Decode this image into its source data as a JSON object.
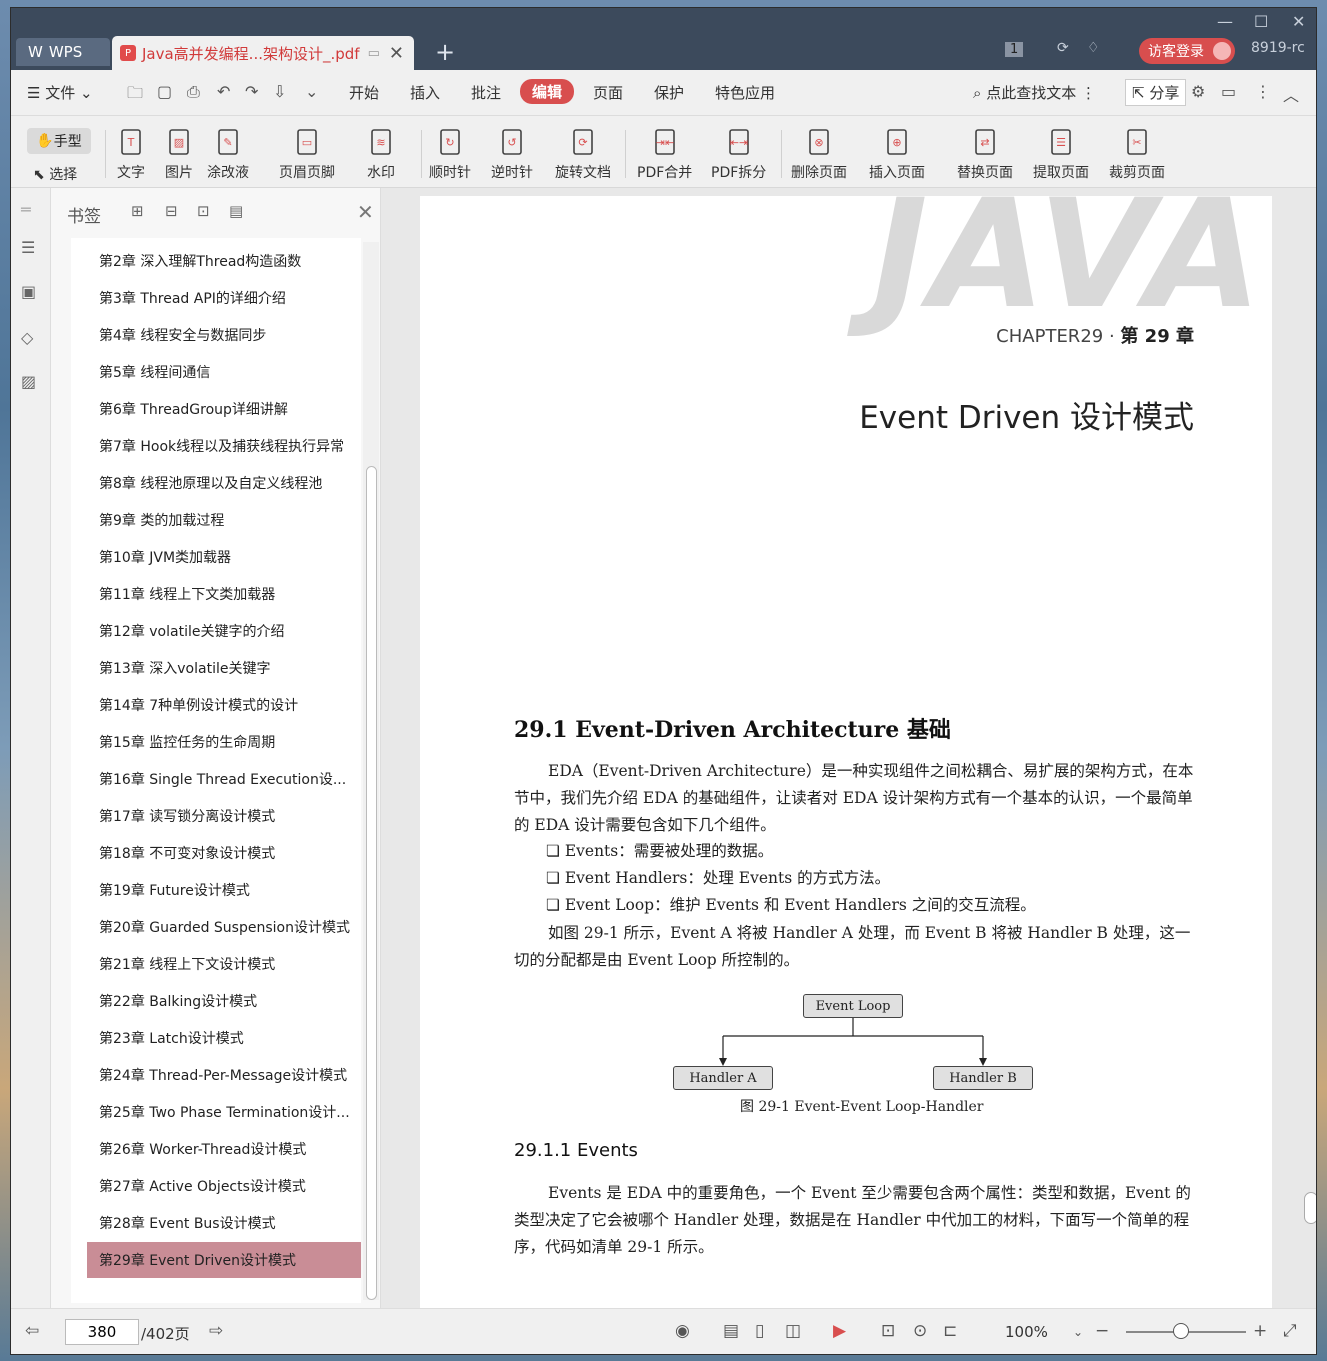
{
  "app": {
    "name": "WPS",
    "tab_title": "Java高并发编程...架构设计_.pdf",
    "tab_count": "1",
    "login": "访客登录",
    "user": "8919-rc"
  },
  "menu": {
    "file": "文件",
    "items": [
      "开始",
      "插入",
      "批注",
      "编辑",
      "页面",
      "保护",
      "特色应用"
    ],
    "active": "编辑",
    "search": "点此查找文本",
    "share": "分享"
  },
  "toolbar": {
    "hand": "手型",
    "select": "选择",
    "tools": [
      "文字",
      "图片",
      "涂改液",
      "页眉页脚",
      "水印",
      "顺时针",
      "逆时针",
      "旋转文档",
      "PDF合并",
      "PDF拆分",
      "删除页面",
      "插入页面",
      "替换页面",
      "提取页面",
      "裁剪页面"
    ]
  },
  "bookmarks": {
    "title": "书签",
    "items": [
      "第2章 深入理解Thread构造函数",
      "第3章 Thread API的详细介绍",
      "第4章 线程安全与数据同步",
      "第5章 线程间通信",
      "第6章 ThreadGroup详细讲解",
      "第7章 Hook线程以及捕获线程执行异常",
      "第8章 线程池原理以及自定义线程池",
      "第9章 类的加载过程",
      "第10章 JVM类加载器",
      "第11章 线程上下文类加载器",
      "第12章 volatile关键字的介绍",
      "第13章 深入volatile关键字",
      "第14章 7种单例设计模式的设计",
      "第15章 监控任务的生命周期",
      "第16章 Single Thread Execution设...",
      "第17章 读写锁分离设计模式",
      "第18章 不可变对象设计模式",
      "第19章 Future设计模式",
      "第20章 Guarded Suspension设计模式",
      "第21章 线程上下文设计模式",
      "第22章 Balking设计模式",
      "第23章 Latch设计模式",
      "第24章 Thread-Per-Message设计模式",
      "第25章 Two Phase Termination设计...",
      "第26章 Worker-Thread设计模式",
      "第27章 Active Objects设计模式",
      "第28章 Event Bus设计模式",
      "第29章 Event Driven设计模式"
    ],
    "current": "第29章 Event Driven设计模式"
  },
  "page": {
    "watermark": "JAVA",
    "chapter_en": "CHAPTER29",
    "chapter_cn": "第 29 章",
    "title": "Event Driven 设计模式",
    "h2": "29.1   Event-Driven Architecture 基础",
    "p1": "EDA（Event-Driven Architecture）是一种实现组件之间松耦合、易扩展的架构方式，在本节中，我们先介绍 EDA 的基础组件，让读者对 EDA 设计架构方式有一个基本的认识，一个最简单的 EDA 设计需要包含如下几个组件。",
    "b1": "❏ Events：需要被处理的数据。",
    "b2": "❏ Event Handlers：处理 Events 的方式方法。",
    "b3": "❏ Event Loop：维护 Events 和 Event Handlers 之间的交互流程。",
    "p2": "如图 29-1 所示，Event A 将被 Handler A 处理，而 Event B 将被 Handler B 处理，这一切的分配都是由 Event Loop 所控制的。",
    "diagram": {
      "loop": "Event Loop",
      "ha": "Handler A",
      "hb": "Handler B",
      "caption": "图 29-1    Event-Event Loop-Handler"
    },
    "h3": "29.1.1    Events",
    "p3": "Events 是 EDA 中的重要角色，一个 Event 至少需要包含两个属性：类型和数据，Event 的类型决定了它会被哪个 Handler 处理，数据是在 Handler 中代加工的材料，下面写一个简单的程序，代码如清单 29-1 所示。"
  },
  "status": {
    "page": "380",
    "total": "/402页",
    "zoom": "100%"
  }
}
